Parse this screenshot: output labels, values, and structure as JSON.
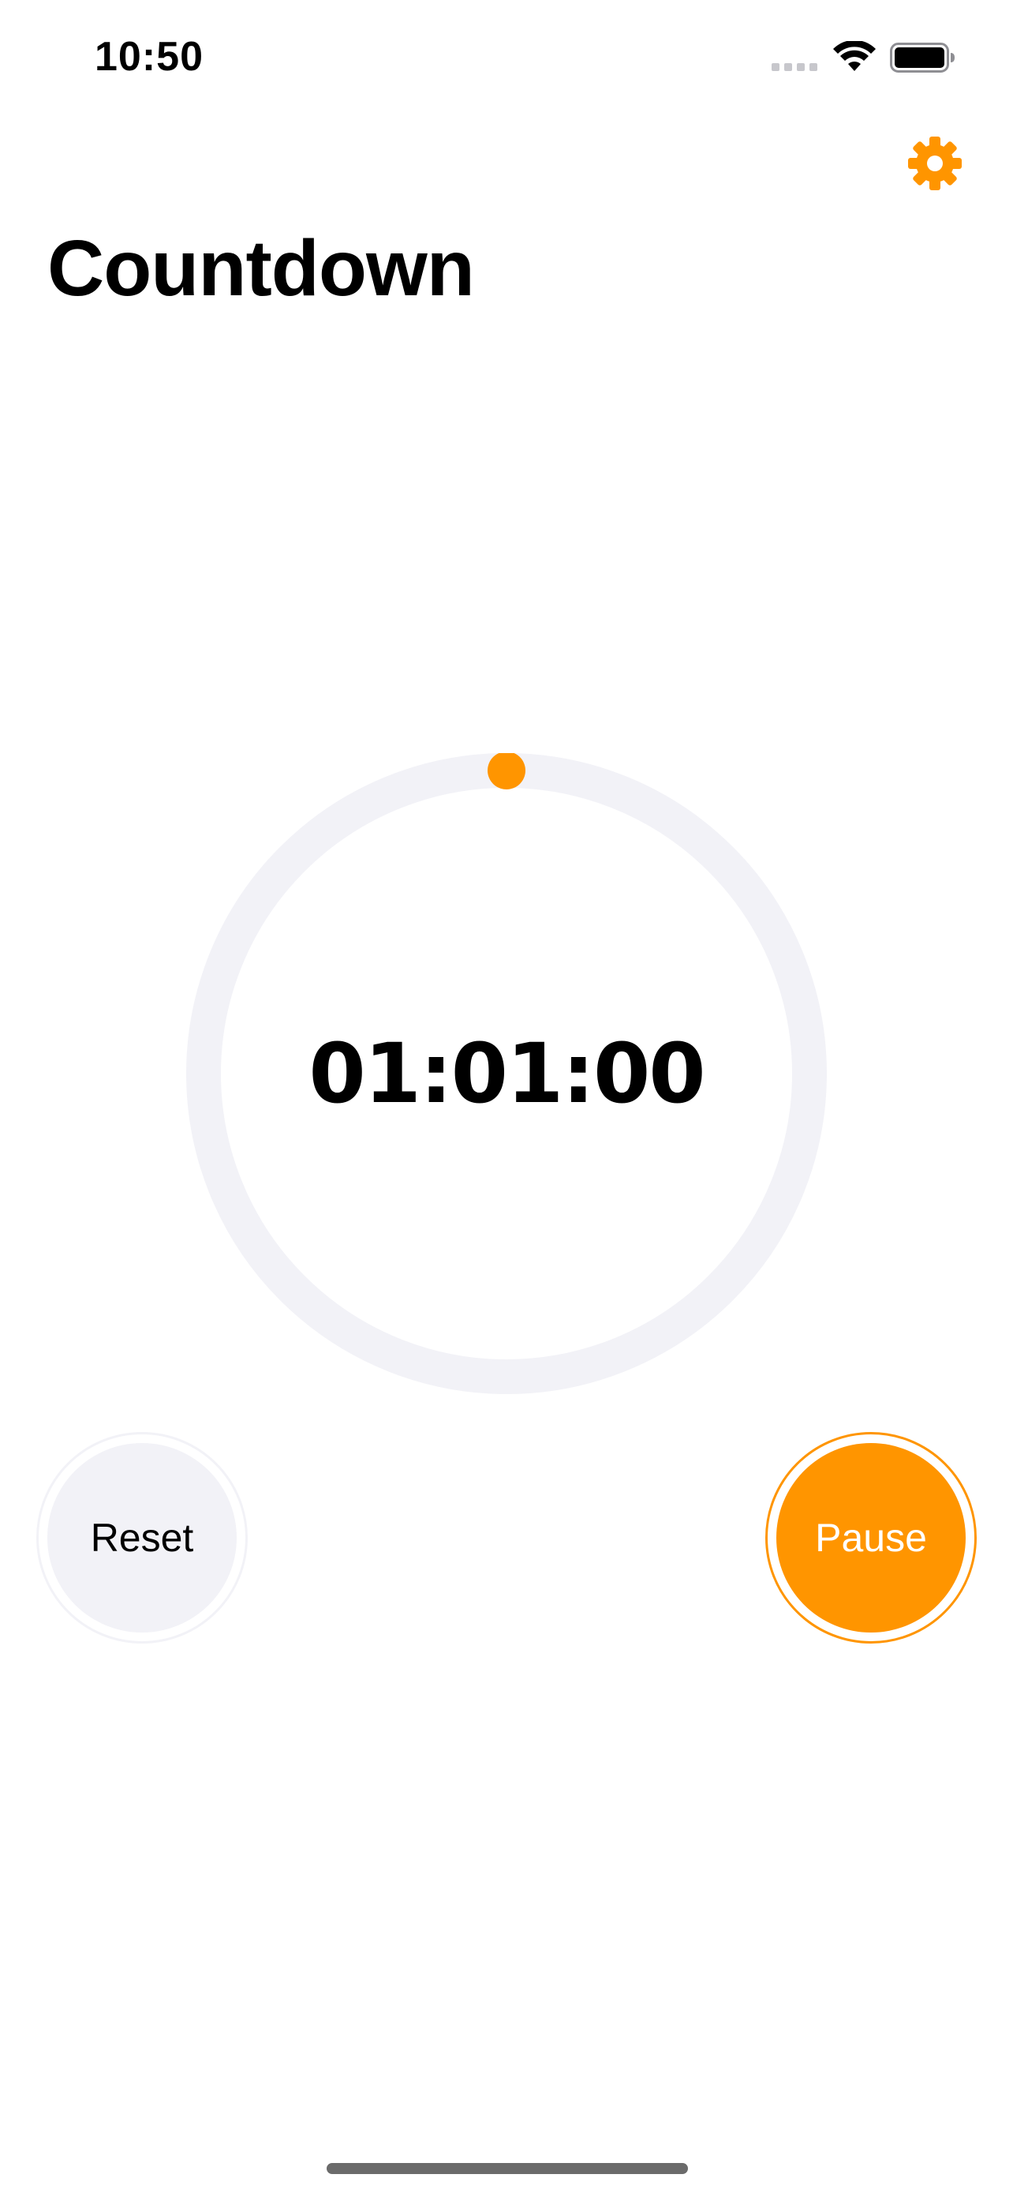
{
  "status_bar": {
    "time": "10:50"
  },
  "header": {
    "title": "Countdown",
    "settings_icon": "gear-icon"
  },
  "timer": {
    "display": "01:01:00",
    "progress_remaining": 1.0
  },
  "controls": {
    "reset_label": "Reset",
    "pause_label": "Pause"
  },
  "colors": {
    "accent": "#ff9500",
    "ring_track": "#f2f2f7",
    "secondary_button": "#f2f2f7"
  }
}
